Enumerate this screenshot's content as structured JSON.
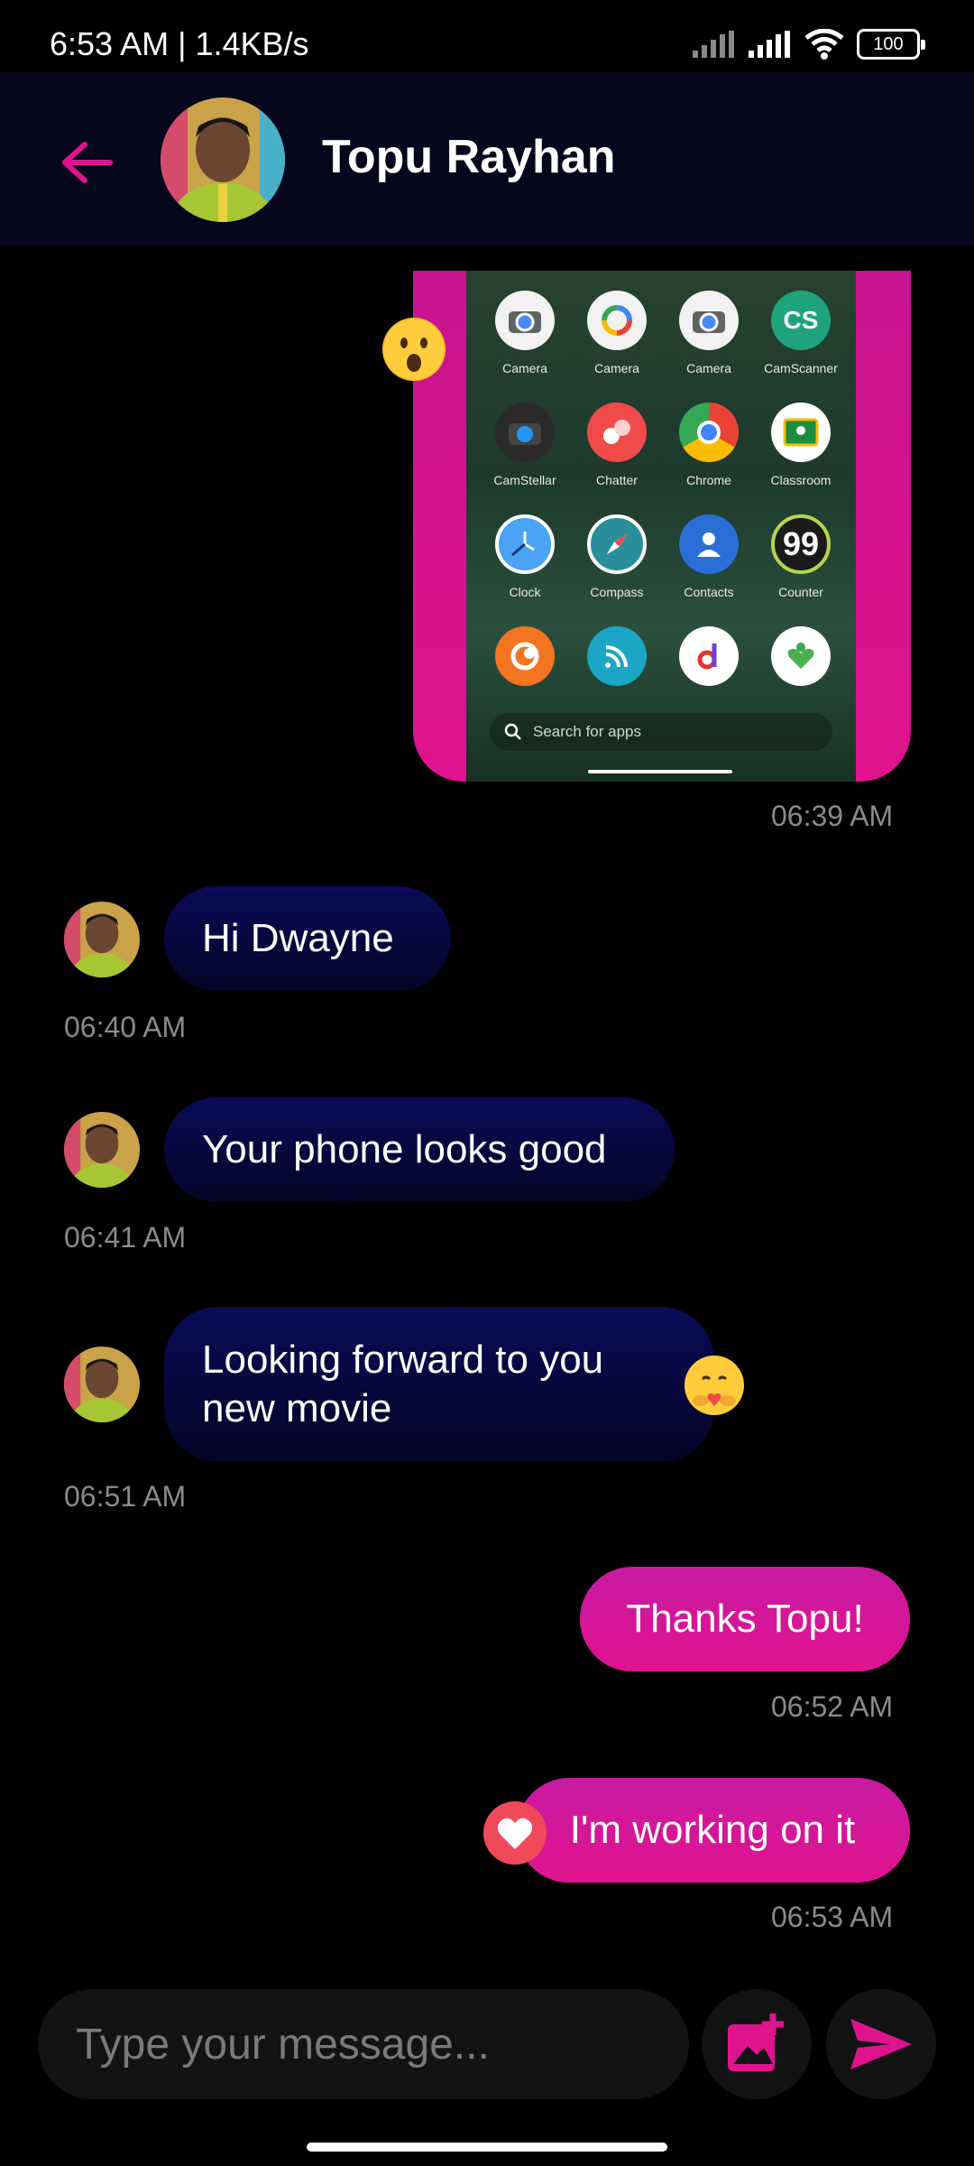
{
  "status_bar": {
    "time_speed": "6:53 AM | 1.4KB/s",
    "battery": "100"
  },
  "header": {
    "contact_name": "Topu Rayhan",
    "back_icon": "arrow-left-icon"
  },
  "colors": {
    "accent": "#e0138e",
    "incoming_bubble": "#0b0b58",
    "header_bg": "#06061c",
    "background": "#000000"
  },
  "shared_image": {
    "apps": [
      {
        "label": "Camera"
      },
      {
        "label": "Camera"
      },
      {
        "label": "Camera"
      },
      {
        "label": "CamScanner"
      },
      {
        "label": "CamStellar"
      },
      {
        "label": "Chatter"
      },
      {
        "label": "Chrome"
      },
      {
        "label": "Classroom"
      },
      {
        "label": "Clock"
      },
      {
        "label": "Compass"
      },
      {
        "label": "Contacts"
      },
      {
        "label": "Counter"
      },
      {
        "label": ""
      },
      {
        "label": ""
      },
      {
        "label": ""
      },
      {
        "label": ""
      }
    ],
    "camscanner_text": "CS",
    "counter_text": "99",
    "search_placeholder": "Search for apps",
    "reaction": "astonished-face"
  },
  "messages": [
    {
      "direction": "out",
      "type": "image",
      "time": "06:39 AM"
    },
    {
      "direction": "in",
      "text": "Hi Dwayne",
      "time": "06:40 AM"
    },
    {
      "direction": "in",
      "text": "Your phone looks good",
      "time": "06:41 AM"
    },
    {
      "direction": "in",
      "text": "Looking forward to you new movie",
      "time": "06:51 AM",
      "reaction": "hugging-face"
    },
    {
      "direction": "out",
      "text": "Thanks Topu!",
      "time": "06:52 AM"
    },
    {
      "direction": "out",
      "text": "I'm working on it",
      "time": "06:53 AM",
      "reaction": "heart"
    }
  ],
  "composer": {
    "placeholder": "Type your message...",
    "attach_icon": "add-image-icon",
    "send_icon": "send-icon"
  }
}
